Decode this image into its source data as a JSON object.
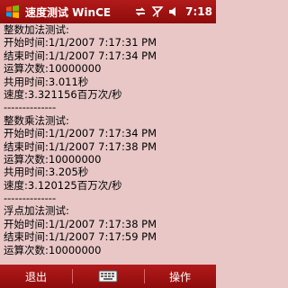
{
  "titlebar": {
    "title": "速度测试 WinCE",
    "clock": "7:18",
    "icons": [
      "windows-start-icon",
      "sync-icon",
      "antenna-icon",
      "speaker-icon"
    ]
  },
  "content": {
    "lines": [
      "整数加法测试:",
      "开始时间:1/1/2007 7:17:31 PM",
      "结束时间:1/1/2007 7:17:34 PM",
      "运算次数:10000000",
      "共用时间:3.011秒",
      "速度:3.321156百万次/秒",
      "--------------",
      "整数乘法测试:",
      "开始时间:1/1/2007 7:17:34 PM",
      "结束时间:1/1/2007 7:17:38 PM",
      "运算次数:10000000",
      "共用时间:3.205秒",
      "速度:3.120125百万次/秒",
      "--------------",
      "浮点加法测试:",
      "开始时间:1/1/2007 7:17:38 PM",
      "结束时间:1/1/2007 7:17:59 PM",
      "运算次数:10000000"
    ]
  },
  "menubar": {
    "left": "退出",
    "right": "操作",
    "keyboard_icon": "keyboard-icon"
  },
  "colors": {
    "bar": "#a01414",
    "background": "#e9c7c7"
  }
}
